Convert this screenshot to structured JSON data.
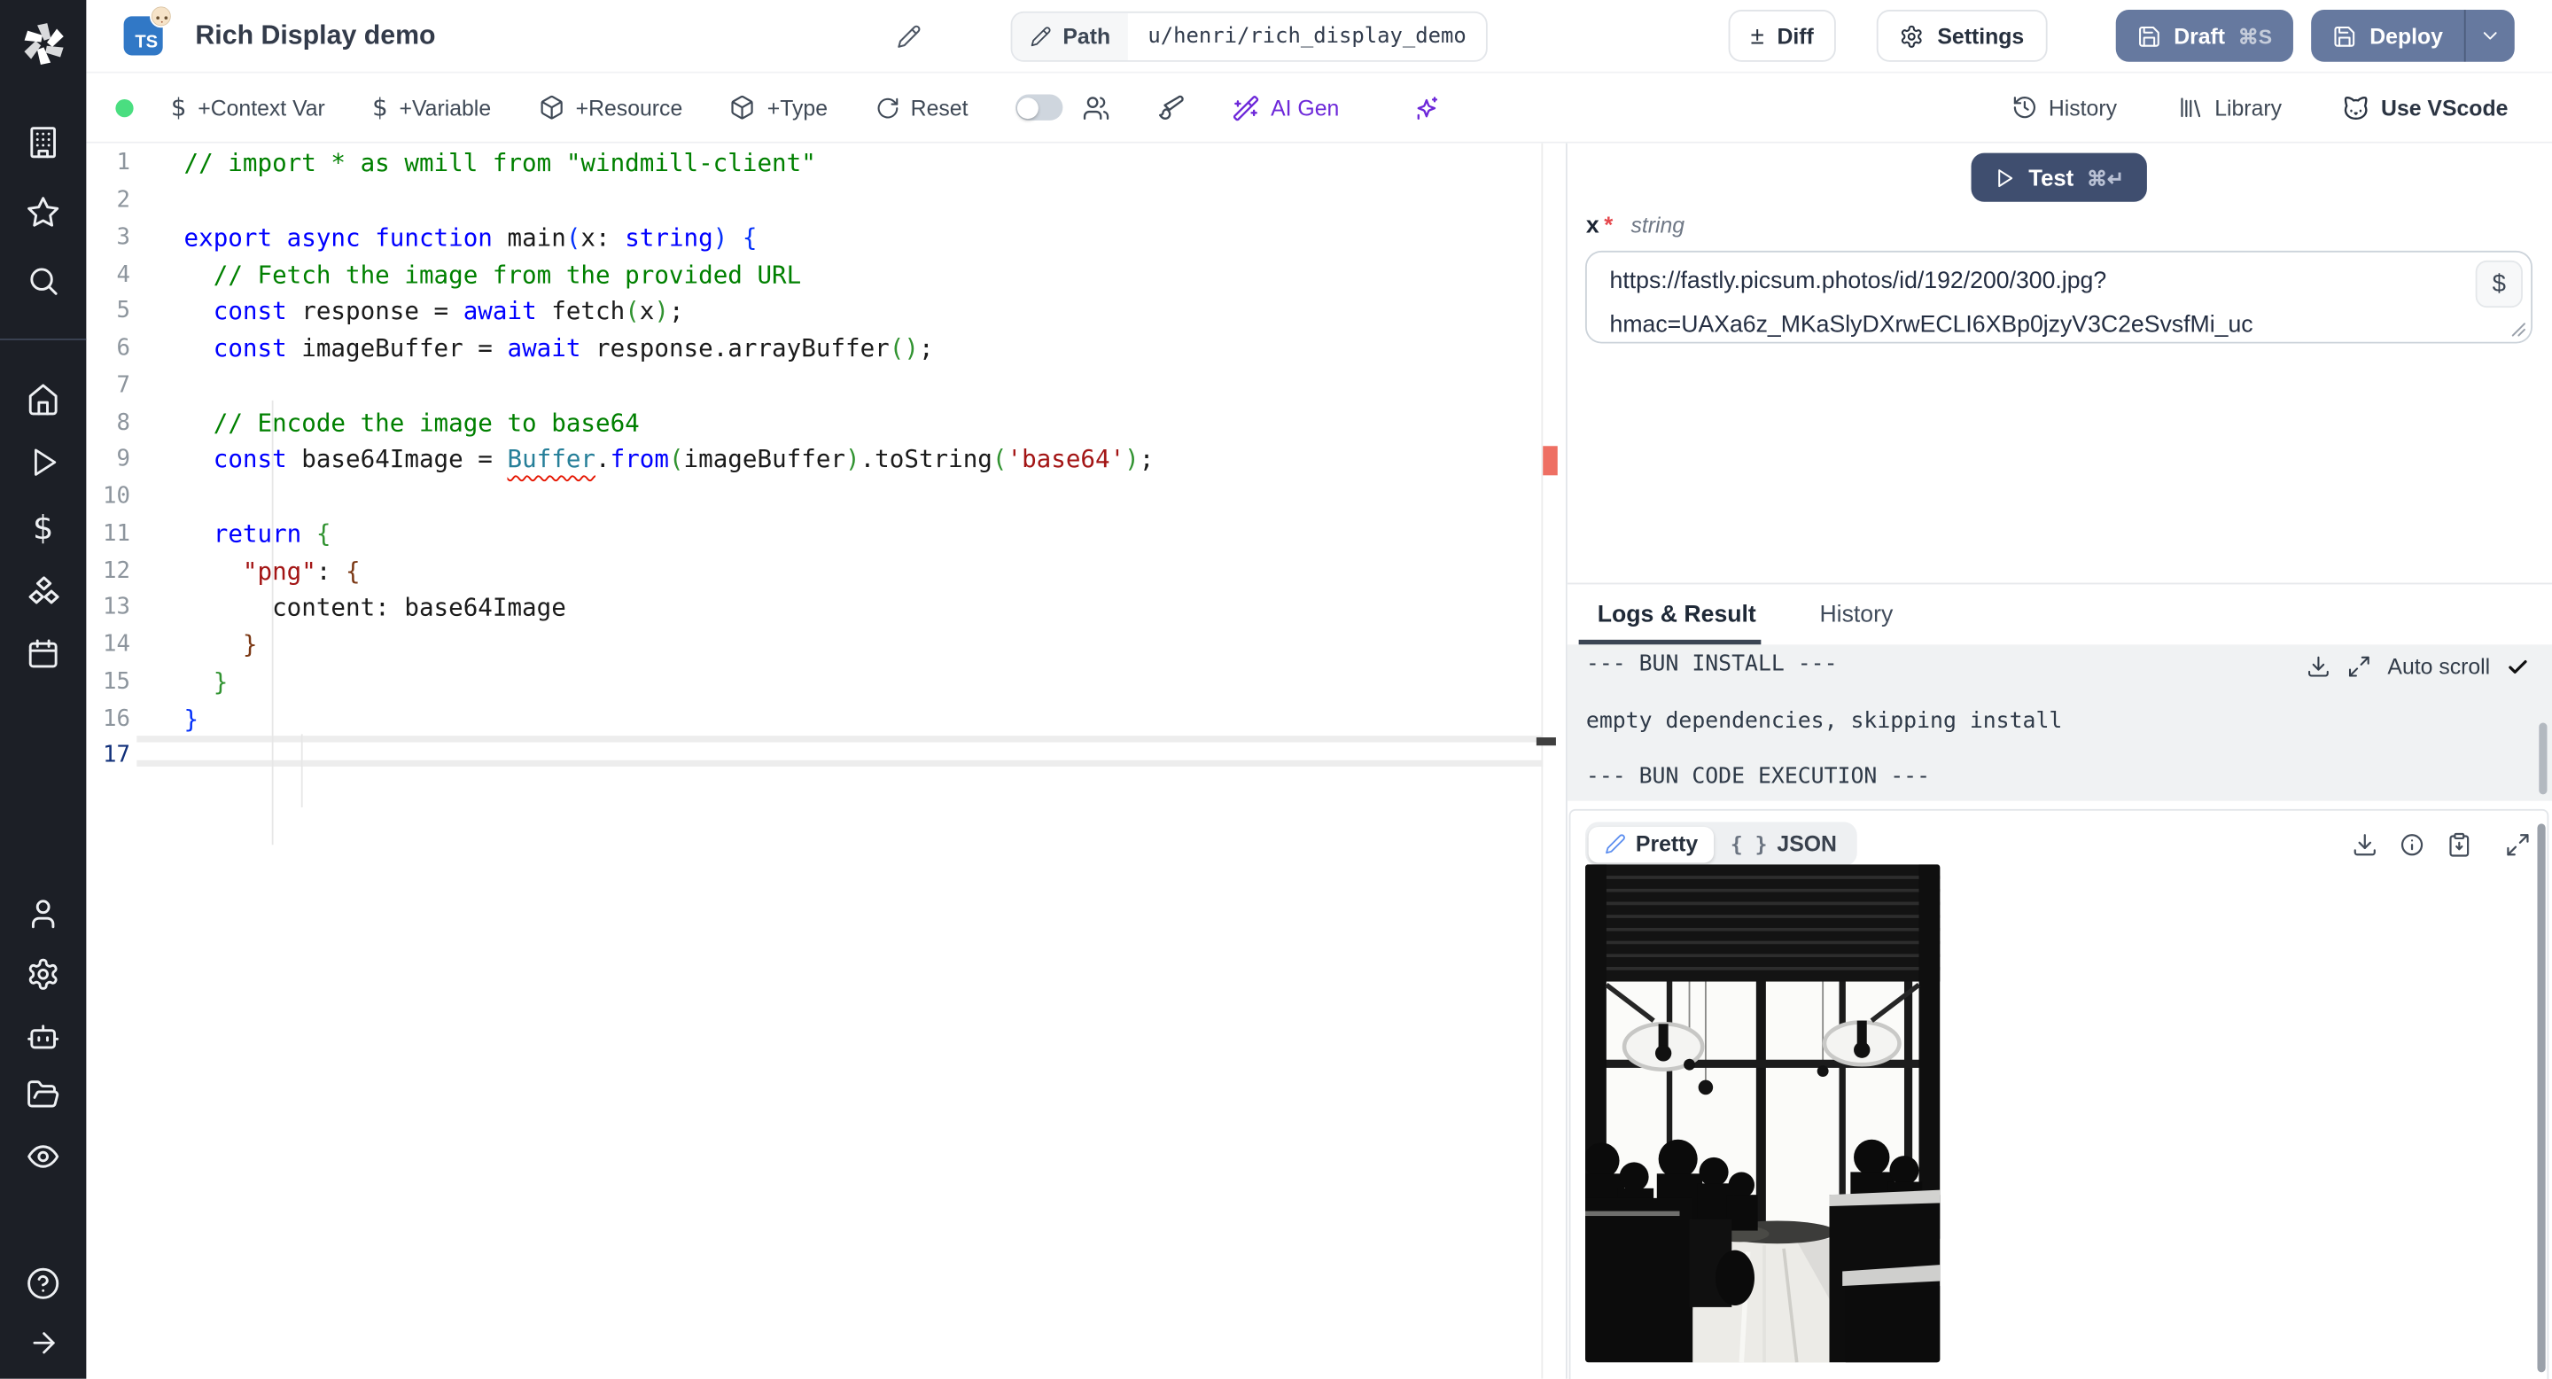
{
  "header": {
    "language_badge": "TS",
    "title": "Rich Display demo",
    "path_label": "Path",
    "path_value": "u/henri/rich_display_demo",
    "diff_label": "Diff",
    "settings_label": "Settings",
    "draft_label": "Draft",
    "draft_shortcut": "⌘S",
    "deploy_label": "Deploy"
  },
  "toolbar": {
    "context_var_label": "+Context Var",
    "variable_label": "+Variable",
    "resource_label": "+Resource",
    "type_label": "+Type",
    "reset_label": "Reset",
    "ai_gen_label": "AI Gen",
    "history_label": "History",
    "library_label": "Library",
    "vscode_label": "Use VScode"
  },
  "editor": {
    "active_line": 17,
    "lines": [
      {
        "n": 1,
        "seg": [
          [
            "cmt",
            "// import * as wmill from \"windmill-client\""
          ]
        ]
      },
      {
        "n": 2,
        "seg": []
      },
      {
        "n": 3,
        "seg": [
          [
            "kw",
            "export"
          ],
          [
            "pl",
            " "
          ],
          [
            "kw",
            "async"
          ],
          [
            "pl",
            " "
          ],
          [
            "kw",
            "function"
          ],
          [
            "pl",
            " main"
          ],
          [
            "b1",
            "("
          ],
          [
            "pl",
            "x: "
          ],
          [
            "kw",
            "string"
          ],
          [
            "b1",
            ")"
          ],
          [
            "pl",
            " "
          ],
          [
            "b1",
            "{"
          ]
        ]
      },
      {
        "n": 4,
        "seg": [
          [
            "pl",
            "  "
          ],
          [
            "cmt",
            "// Fetch the image from the provided URL"
          ]
        ]
      },
      {
        "n": 5,
        "seg": [
          [
            "pl",
            "  "
          ],
          [
            "kw",
            "const"
          ],
          [
            "pl",
            " response = "
          ],
          [
            "kw",
            "await"
          ],
          [
            "pl",
            " fetch"
          ],
          [
            "b2",
            "("
          ],
          [
            "pl",
            "x"
          ],
          [
            "b2",
            ")"
          ],
          [
            "pl",
            ";"
          ]
        ]
      },
      {
        "n": 6,
        "seg": [
          [
            "pl",
            "  "
          ],
          [
            "kw",
            "const"
          ],
          [
            "pl",
            " imageBuffer = "
          ],
          [
            "kw",
            "await"
          ],
          [
            "pl",
            " response.arrayBuffer"
          ],
          [
            "b2",
            "("
          ],
          [
            "b2",
            ")"
          ],
          [
            "pl",
            ";"
          ]
        ]
      },
      {
        "n": 7,
        "seg": []
      },
      {
        "n": 8,
        "seg": [
          [
            "pl",
            "  "
          ],
          [
            "cmt",
            "// Encode the image to base64"
          ]
        ]
      },
      {
        "n": 9,
        "seg": [
          [
            "pl",
            "  "
          ],
          [
            "kw",
            "const"
          ],
          [
            "pl",
            " base64Image = "
          ],
          [
            "err",
            "Buffer"
          ],
          [
            "pl",
            "."
          ],
          [
            "kw",
            "from"
          ],
          [
            "b2",
            "("
          ],
          [
            "pl",
            "imageBuffer"
          ],
          [
            "b2",
            ")"
          ],
          [
            "pl",
            ".toString"
          ],
          [
            "b2",
            "("
          ],
          [
            "str",
            "'base64'"
          ],
          [
            "b2",
            ")"
          ],
          [
            "pl",
            ";"
          ]
        ]
      },
      {
        "n": 10,
        "seg": []
      },
      {
        "n": 11,
        "seg": [
          [
            "pl",
            "  "
          ],
          [
            "kw",
            "return"
          ],
          [
            "pl",
            " "
          ],
          [
            "b2",
            "{"
          ]
        ]
      },
      {
        "n": 12,
        "seg": [
          [
            "pl",
            "    "
          ],
          [
            "str",
            "\"png\""
          ],
          [
            "pl",
            ": "
          ],
          [
            "b3",
            "{"
          ]
        ]
      },
      {
        "n": 13,
        "seg": [
          [
            "pl",
            "      content: base64Image"
          ]
        ]
      },
      {
        "n": 14,
        "seg": [
          [
            "pl",
            "    "
          ],
          [
            "b3",
            "}"
          ]
        ]
      },
      {
        "n": 15,
        "seg": [
          [
            "pl",
            "  "
          ],
          [
            "b2",
            "}"
          ]
        ]
      },
      {
        "n": 16,
        "seg": [
          [
            "b1",
            "}"
          ]
        ]
      },
      {
        "n": 17,
        "seg": []
      }
    ]
  },
  "run_panel": {
    "test_label": "Test",
    "test_shortcut": "⌘↵",
    "arg_name": "x",
    "required_marker": "*",
    "arg_type": "string",
    "input_value": "https://fastly.picsum.photos/id/192/200/300.jpg?hmac=UAXa6z_MKaSlyDXrwECLI6XBp0jzyV3C2eSvsfMi_uc",
    "input_lines": [
      "https://fastly.picsum.photos/id/192/200/300.jpg?",
      "hmac=UAXa6z_MKaSlyDXrwECLI6XBp0jzyV3C2eSvsfMi_uc"
    ],
    "dollar_button": "$"
  },
  "results": {
    "tab_logs": "Logs & Result",
    "tab_history": "History",
    "auto_scroll_label": "Auto scroll",
    "log_lines": [
      "--- BUN INSTALL ---",
      "",
      "empty dependencies, skipping install",
      "",
      "--- BUN CODE EXECUTION ---"
    ],
    "view_pretty": "Pretty",
    "view_json": "JSON",
    "result_image_alt": "black and white photo of silhouetted people at tables before large bright windows with pendant lamps"
  },
  "colors": {
    "ts_badge": "#3178c6",
    "draft_deploy_button": "#66799f",
    "test_button": "#3f4e6f",
    "ai_accent": "#6d28d9",
    "status_green": "#4ade80",
    "error_red": "#e51400"
  }
}
